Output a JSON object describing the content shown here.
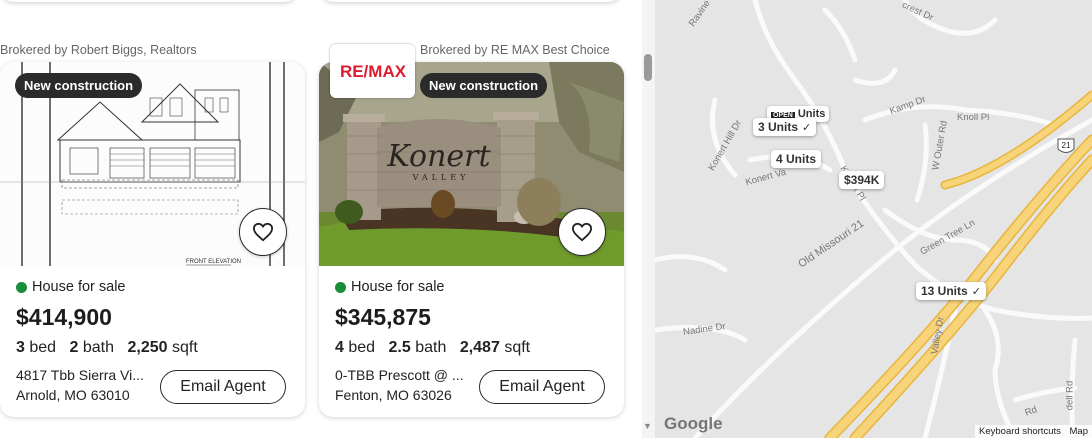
{
  "listings": [
    {
      "broker": "Brokered by Robert Biggs, Realtors",
      "badge": "New construction",
      "status": "House for sale",
      "price": "$414,900",
      "beds": "3",
      "bed_label": "bed",
      "baths": "2",
      "bath_label": "bath",
      "sqft": "2,250",
      "sqft_label": "sqft",
      "address_line1": "4817 Tbb Sierra Vi...",
      "address_line2": "Arnold, MO 63010",
      "email_label": "Email Agent",
      "photo_caption": "FRONT ELEVATION"
    },
    {
      "broker": "Brokered by RE MAX Best Choice",
      "broker_logo": "RE/MAX",
      "badge": "New construction",
      "status": "House for sale",
      "price": "$345,875",
      "beds": "4",
      "bed_label": "bed",
      "baths": "2.5",
      "bath_label": "bath",
      "sqft": "2,487",
      "sqft_label": "sqft",
      "address_line1": "0-TBB Prescott @ ...",
      "address_line2": "Fenton, MO 63026",
      "email_label": "Email Agent",
      "sign_text": "Konert",
      "sign_subtext": "VALLEY"
    }
  ],
  "map": {
    "pins": {
      "open_tag": "OPEN",
      "pin1": "3 Units",
      "pin1_overlap": "Units",
      "pin2": "4 Units",
      "pin3": "$394K",
      "pin4": "13 Units"
    },
    "roads": {
      "old_missouri": "Old Missouri 21",
      "konert_pl": "Konert Pl",
      "konert_hill": "Konert Hill Dr",
      "konert_valley": "Konert Va",
      "kamp": "Kamp Dr",
      "knoll": "Knoll Pl",
      "w_outer": "W Outer Rd",
      "green_tree": "Green Tree Ln",
      "nadine": "Nadine Dr",
      "valley": "Valley Dr",
      "dell": "dell Rd",
      "outer_rd": "Rd",
      "crest": "crest Dr",
      "ravine": "Ravine"
    },
    "shield": "21",
    "google": "Google",
    "keyboard": "Keyboard shortcuts",
    "map_data": "Map"
  },
  "colors": {
    "status_green": "#1a8d3a",
    "highway": "#f2c14e",
    "remax_red": "#dc1c2e",
    "remax_blue": "#003da5"
  }
}
